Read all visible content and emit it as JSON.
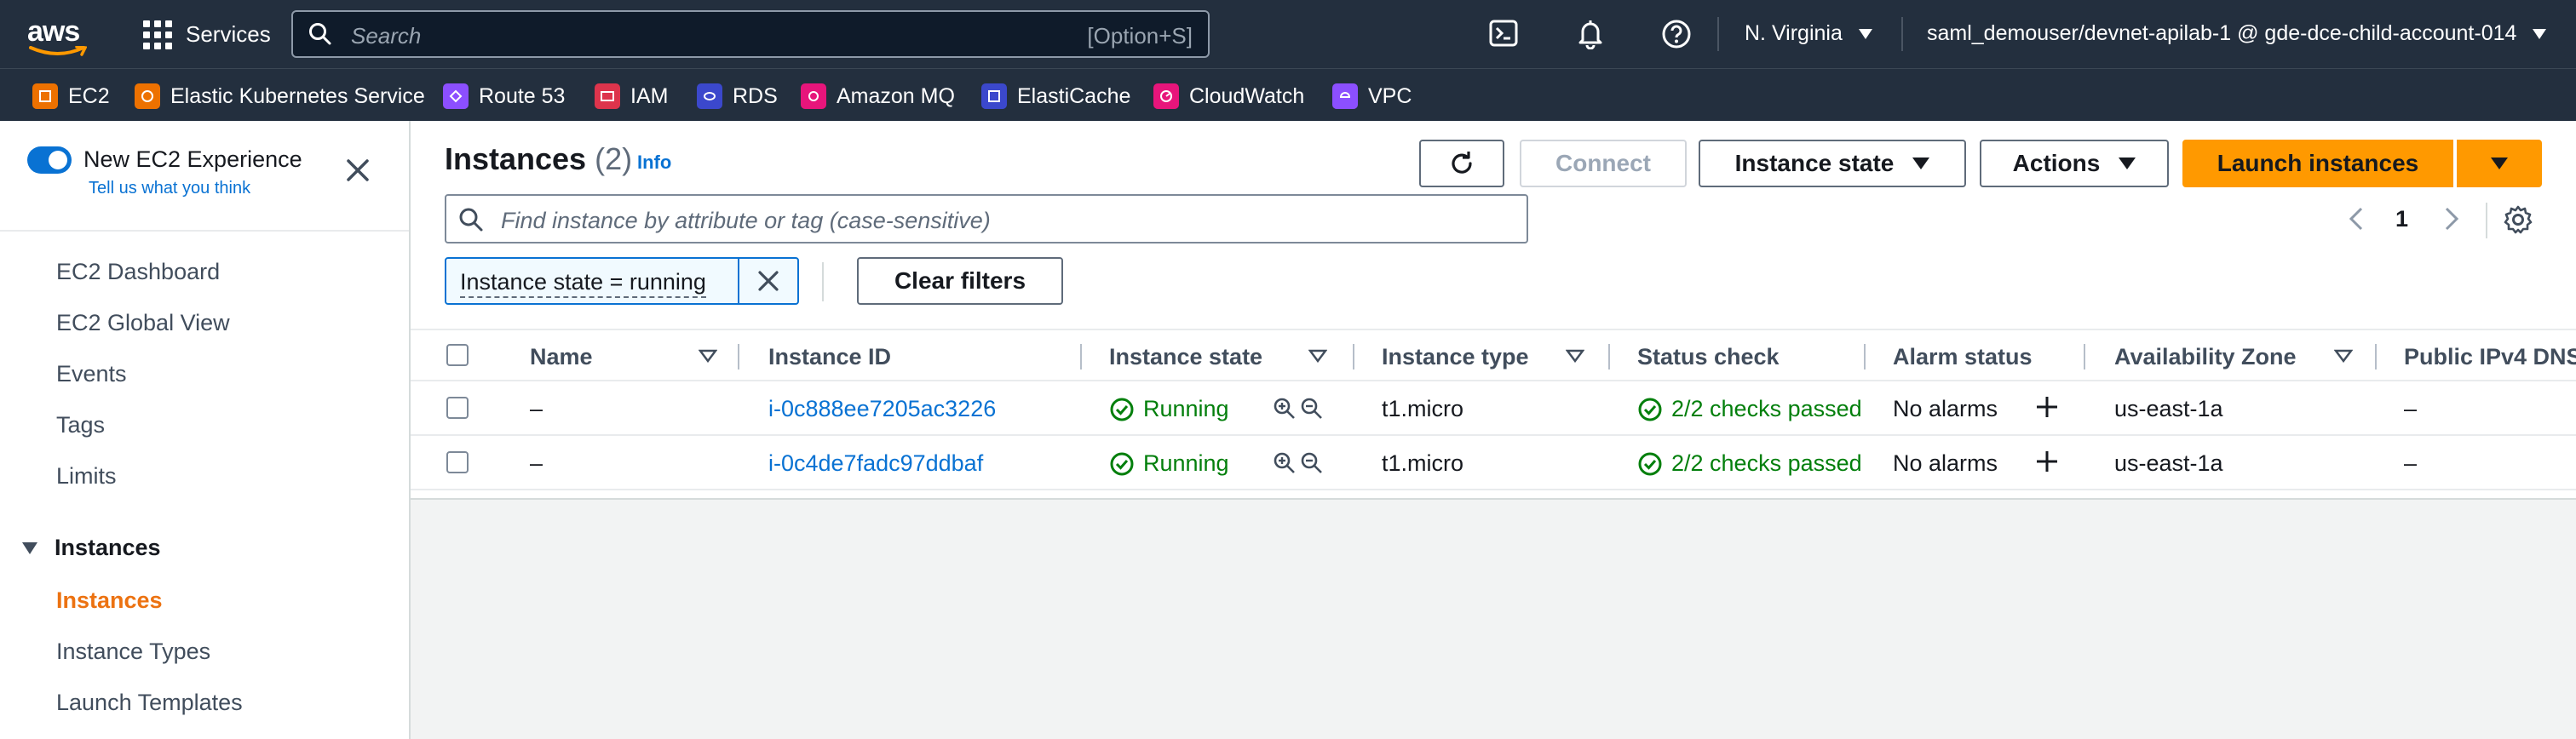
{
  "topnav": {
    "logo_text": "aws",
    "services_label": "Services",
    "search_placeholder": "Search",
    "search_shortcut": "[Option+S]",
    "region": "N. Virginia",
    "account": "saml_demouser/devnet-apilab-1 @ gde-dce-child-account-014"
  },
  "favorites": [
    {
      "label": "EC2",
      "color": "#ed7100"
    },
    {
      "label": "Elastic Kubernetes Service",
      "color": "#ed7100"
    },
    {
      "label": "Route 53",
      "color": "#8c4fff"
    },
    {
      "label": "IAM",
      "color": "#dd344c"
    },
    {
      "label": "RDS",
      "color": "#3b48cc"
    },
    {
      "label": "Amazon MQ",
      "color": "#e7157b"
    },
    {
      "label": "ElastiCache",
      "color": "#3b48cc"
    },
    {
      "label": "CloudWatch",
      "color": "#e7157b"
    },
    {
      "label": "VPC",
      "color": "#8c4fff"
    }
  ],
  "sidebar": {
    "toggle_label": "New EC2 Experience",
    "feedback_link": "Tell us what you think",
    "items": [
      {
        "label": "EC2 Dashboard"
      },
      {
        "label": "EC2 Global View"
      },
      {
        "label": "Events"
      },
      {
        "label": "Tags"
      },
      {
        "label": "Limits"
      }
    ],
    "section": "Instances",
    "section_items": [
      {
        "label": "Instances",
        "active": true
      },
      {
        "label": "Instance Types"
      },
      {
        "label": "Launch Templates"
      }
    ]
  },
  "main": {
    "title": "Instances",
    "count": "(2)",
    "info": "Info",
    "buttons": {
      "connect": "Connect",
      "instance_state": "Instance state",
      "actions": "Actions",
      "launch": "Launch instances"
    },
    "find_placeholder": "Find instance by attribute or tag (case-sensitive)",
    "page_number": "1",
    "filter_token": "Instance state = running",
    "clear_filters": "Clear filters",
    "columns": [
      "Name",
      "Instance ID",
      "Instance state",
      "Instance type",
      "Status check",
      "Alarm status",
      "Availability Zone",
      "Public IPv4 DNS"
    ],
    "rows": [
      {
        "name": "–",
        "id": "i-0c888ee7205ac3226",
        "state": "Running",
        "type": "t1.micro",
        "status": "2/2 checks passed",
        "alarm": "No alarms",
        "az": "us-east-1a",
        "dns": "–"
      },
      {
        "name": "–",
        "id": "i-0c4de7fadc97ddbaf",
        "state": "Running",
        "type": "t1.micro",
        "status": "2/2 checks passed",
        "alarm": "No alarms",
        "az": "us-east-1a",
        "dns": "–"
      }
    ]
  },
  "colors": {
    "nav_bg": "#232f3e",
    "link": "#0972d3",
    "primary": "#ff9900",
    "success": "#037f0c",
    "active_nav": "#ec7211"
  }
}
